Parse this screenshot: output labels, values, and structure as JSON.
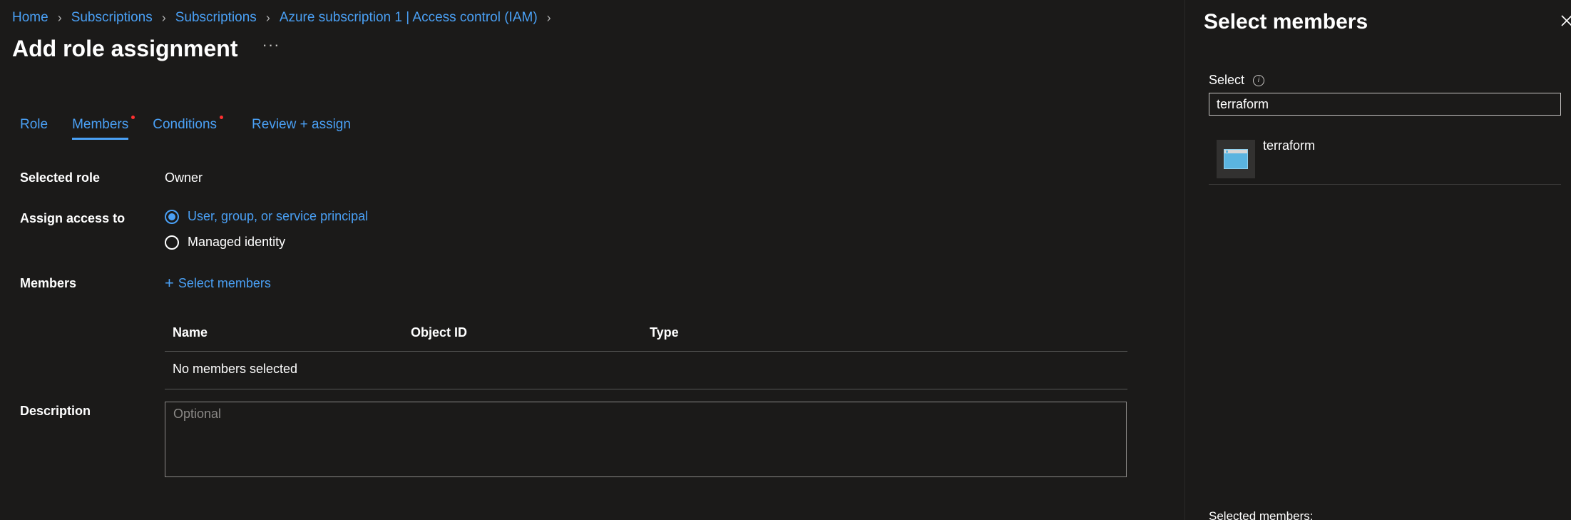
{
  "breadcrumb": {
    "items": [
      "Home",
      "Subscriptions",
      "Subscriptions",
      "Azure subscription 1 | Access control (IAM)"
    ],
    "separator": ">"
  },
  "header": {
    "title": "Add role assignment",
    "more_label": "···"
  },
  "tabs": [
    {
      "label": "Role",
      "active": false,
      "required_dot": false
    },
    {
      "label": "Members",
      "active": true,
      "required_dot": true
    },
    {
      "label": "Conditions",
      "active": false,
      "required_dot": true
    },
    {
      "label": "Review + assign",
      "active": false,
      "required_dot": false
    }
  ],
  "form": {
    "selected_role_label": "Selected role",
    "selected_role_value": "Owner",
    "assign_access_label": "Assign access to",
    "assign_options": [
      {
        "label": "User, group, or service principal",
        "checked": true
      },
      {
        "label": "Managed identity",
        "checked": false
      }
    ],
    "members_label": "Members",
    "select_members_link": "Select members",
    "table": {
      "columns": [
        "Name",
        "Object ID",
        "Type"
      ],
      "empty_text": "No members selected"
    },
    "description_label": "Description",
    "description_placeholder": "Optional",
    "description_value": ""
  },
  "panel": {
    "title": "Select members",
    "select_label": "Select",
    "search_value": "terraform",
    "results": [
      {
        "name": "terraform",
        "icon": "app-registration-icon"
      }
    ],
    "selected_members_label": "Selected members:"
  },
  "colors": {
    "background": "#1b1a19",
    "link": "#4aa0f5",
    "required_dot": "#ff3030",
    "border": "#8a8886"
  }
}
